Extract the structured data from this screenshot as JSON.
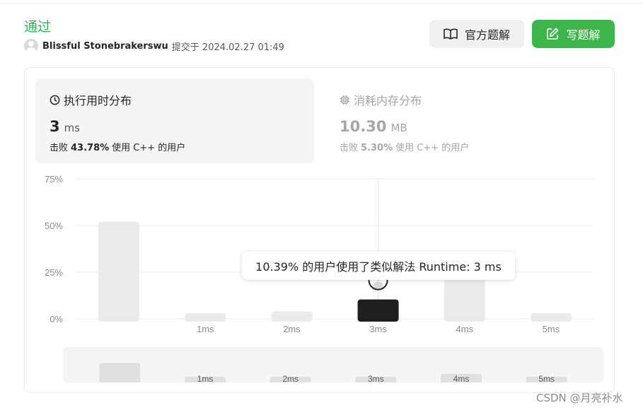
{
  "status": "通过",
  "submission": {
    "username": "Blissful Stonebrakerswu",
    "submit_text": "提交于 2024.02.27 01:49"
  },
  "buttons": {
    "official": "官方题解",
    "write": "写题解"
  },
  "runtime": {
    "title": "执行用时分布",
    "value": "3",
    "unit": "ms",
    "beat_prefix": "击败",
    "beat_percent": "43.78%",
    "beat_suffix": "使用 C++ 的用户"
  },
  "memory": {
    "title": "消耗内存分布",
    "value": "10.30",
    "unit": "MB",
    "beat_prefix": "击败",
    "beat_percent": "5.30%",
    "beat_suffix": "使用 C++ 的用户"
  },
  "tooltip": "10.39% 的用户使用了类似解法 Runtime: 3 ms",
  "watermark": "CSDN @月亮补水",
  "colors": {
    "accepted_green": "#2db55d",
    "write_button": "#3cb54a",
    "highlight_bar": "#1f1f1f",
    "bar": "#ebebeb"
  },
  "chart_data": {
    "type": "bar",
    "categories": [
      "",
      "1ms",
      "2ms",
      "3ms",
      "4ms",
      "5ms"
    ],
    "values": [
      52,
      3,
      4,
      10.39,
      23,
      3
    ],
    "highlight_index": 3,
    "ytick_labels": [
      "0%",
      "25%",
      "50%",
      "75%"
    ],
    "yticks": [
      0,
      25,
      50,
      75
    ],
    "ylim": [
      0,
      75
    ],
    "grid": true,
    "unit": "%"
  },
  "minimap": {
    "labels": [
      "",
      "1ms",
      "2ms",
      "3ms",
      "4ms",
      "5ms"
    ]
  }
}
